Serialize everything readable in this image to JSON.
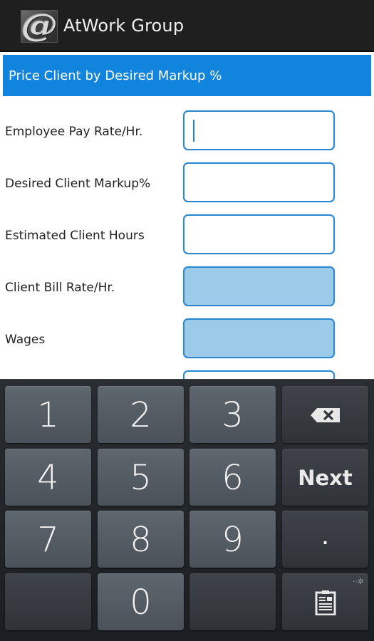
{
  "app": {
    "title": "AtWork Group",
    "icon": "at-sign-logo-icon"
  },
  "section": {
    "title": "Price Client by Desired Markup %"
  },
  "form": {
    "fields": [
      {
        "label": "Employee Pay Rate/Hr.",
        "value": "",
        "readonly": false,
        "focused": true
      },
      {
        "label": "Desired Client Markup%",
        "value": "",
        "readonly": false,
        "focused": false
      },
      {
        "label": "Estimated Client Hours",
        "value": "",
        "readonly": false,
        "focused": false
      },
      {
        "label": "Client Bill Rate/Hr.",
        "value": "",
        "readonly": true,
        "focused": false
      },
      {
        "label": "Wages",
        "value": "",
        "readonly": true,
        "focused": false
      }
    ]
  },
  "keyboard": {
    "keys": {
      "k1": "1",
      "k2": "2",
      "k3": "3",
      "k4": "4",
      "k5": "5",
      "k6": "6",
      "k7": "7",
      "k8": "8",
      "k9": "9",
      "k0": "0",
      "next": "Next",
      "dot": "."
    },
    "icons": {
      "backspace": "backspace-icon",
      "clipboard": "clipboard-icon",
      "settings": "settings-gear-icon"
    }
  },
  "colors": {
    "accent": "#1184dd",
    "input_border": "#2d88cf",
    "readonly_fill": "#9ccbea",
    "action_bar": "#1f1f1f"
  }
}
